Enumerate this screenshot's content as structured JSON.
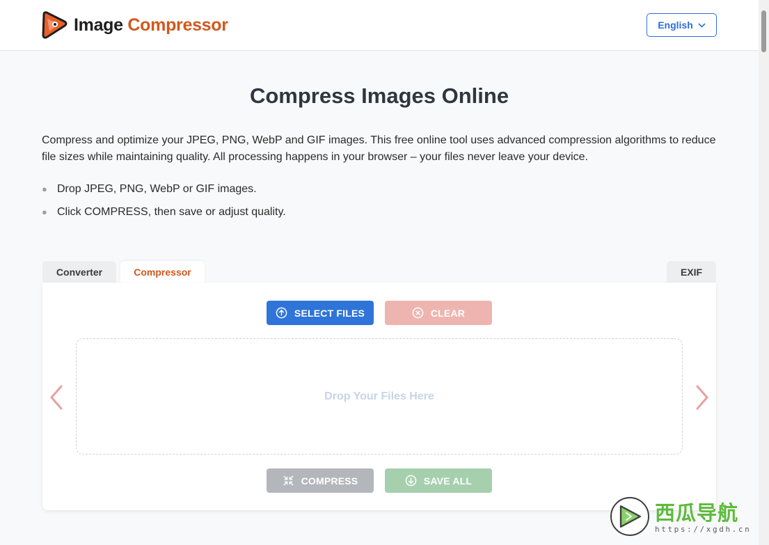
{
  "header": {
    "logo_word1": "Image",
    "logo_word2": "Compressor",
    "logo_icon": "play-arrow-logo-icon",
    "language_label": "English"
  },
  "main": {
    "title": "Compress Images Online",
    "intro": "Compress and optimize your JPEG, PNG, WebP and GIF images. This free online tool uses advanced compression algorithms to reduce file sizes while maintaining quality. All processing happens in your browser – your files never leave your device.",
    "bullets": [
      "Drop JPEG, PNG, WebP or GIF images.",
      "Click COMPRESS, then save or adjust quality."
    ]
  },
  "tabs": {
    "converter": "Converter",
    "compressor": "Compressor",
    "exif": "EXIF",
    "active": "compressor"
  },
  "panel": {
    "select_files_label": "SELECT FILES",
    "clear_label": "CLEAR",
    "drop_text": "Drop Your Files Here",
    "compress_label": "COMPRESS",
    "save_all_label": "SAVE ALL"
  },
  "watermark": {
    "title": "西瓜导航",
    "url": "https://xgdh.cn"
  },
  "colors": {
    "accent_blue": "#2f74d8",
    "brand_orange": "#d2581c",
    "clear_disabled": "#eeb5b0",
    "compress_disabled": "#b3b6ba",
    "save_disabled": "#a6cfae",
    "arrow": "#e8a0a0"
  }
}
